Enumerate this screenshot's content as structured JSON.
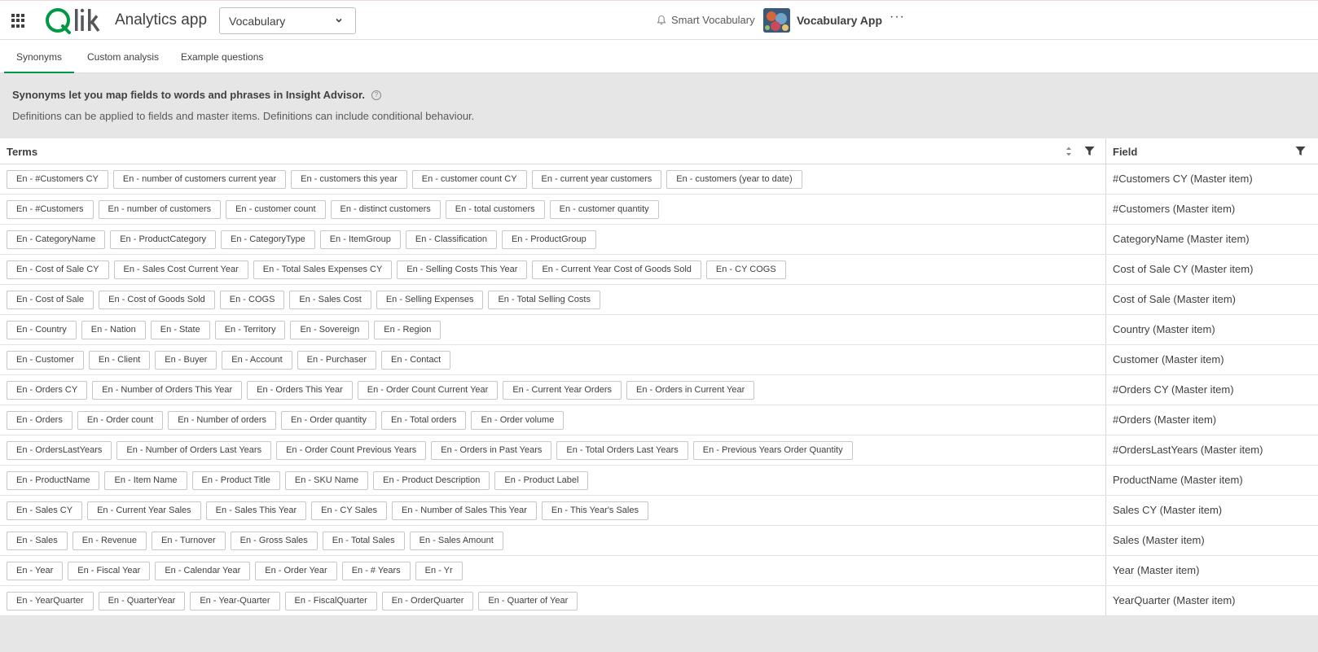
{
  "header": {
    "app_title": "Analytics app",
    "sheet_select_value": "Vocabulary",
    "smart_vocabulary_label": "Smart Vocabulary",
    "vocabulary_app_label": "Vocabulary App",
    "more_label": "···",
    "brand_color": "#009845"
  },
  "tabs": [
    {
      "label": "Synonyms",
      "active": true
    },
    {
      "label": "Custom analysis",
      "active": false
    },
    {
      "label": "Example questions",
      "active": false
    }
  ],
  "info": {
    "title": "Synonyms let you map fields to words and phrases in Insight Advisor.",
    "description": "Definitions can be applied to fields and master items. Definitions can include conditional behaviour."
  },
  "table": {
    "col_terms": "Terms",
    "col_field": "Field",
    "rows": [
      {
        "terms": [
          "En - #Customers CY",
          "En - number of customers current year",
          "En - customers this year",
          "En - customer count CY",
          "En - current year customers",
          "En - customers (year to date)"
        ],
        "field": "#Customers CY (Master item)"
      },
      {
        "terms": [
          "En - #Customers",
          "En - number of customers",
          "En - customer count",
          "En - distinct customers",
          "En - total customers",
          "En - customer quantity"
        ],
        "field": "#Customers (Master item)"
      },
      {
        "terms": [
          "En - CategoryName",
          "En - ProductCategory",
          "En - CategoryType",
          "En - ItemGroup",
          "En - Classification",
          "En - ProductGroup"
        ],
        "field": "CategoryName (Master item)"
      },
      {
        "terms": [
          "En - Cost of Sale CY",
          "En - Sales Cost Current Year",
          "En - Total Sales Expenses CY",
          "En - Selling Costs This Year",
          "En - Current Year Cost of Goods Sold",
          "En - CY COGS"
        ],
        "field": "Cost of Sale CY (Master item)"
      },
      {
        "terms": [
          "En - Cost of Sale",
          "En - Cost of Goods Sold",
          "En - COGS",
          "En - Sales Cost",
          "En - Selling Expenses",
          "En - Total Selling Costs"
        ],
        "field": "Cost of Sale (Master item)"
      },
      {
        "terms": [
          "En - Country",
          "En - Nation",
          "En - State",
          "En - Territory",
          "En - Sovereign",
          "En - Region"
        ],
        "field": "Country (Master item)"
      },
      {
        "terms": [
          "En - Customer",
          "En - Client",
          "En - Buyer",
          "En - Account",
          "En - Purchaser",
          "En - Contact"
        ],
        "field": "Customer (Master item)"
      },
      {
        "terms": [
          "En - Orders CY",
          "En - Number of Orders This Year",
          "En - Orders This Year",
          "En - Order Count Current Year",
          "En - Current Year Orders",
          "En - Orders in Current Year"
        ],
        "field": "#Orders CY (Master item)"
      },
      {
        "terms": [
          "En - Orders",
          "En - Order count",
          "En - Number of orders",
          "En - Order quantity",
          "En - Total orders",
          "En - Order volume"
        ],
        "field": "#Orders (Master item)"
      },
      {
        "terms": [
          "En - OrdersLastYears",
          "En - Number of Orders Last Years",
          "En - Order Count Previous Years",
          "En - Orders in Past Years",
          "En - Total Orders Last Years",
          "En - Previous Years Order Quantity"
        ],
        "field": "#OrdersLastYears (Master item)"
      },
      {
        "terms": [
          "En - ProductName",
          "En - Item Name",
          "En - Product Title",
          "En - SKU Name",
          "En - Product Description",
          "En - Product Label"
        ],
        "field": "ProductName (Master item)"
      },
      {
        "terms": [
          "En - Sales CY",
          "En - Current Year Sales",
          "En - Sales This Year",
          "En - CY Sales",
          "En - Number of Sales This Year",
          "En - This Year's Sales"
        ],
        "field": "Sales CY (Master item)"
      },
      {
        "terms": [
          "En - Sales",
          "En - Revenue",
          "En - Turnover",
          "En - Gross Sales",
          "En - Total Sales",
          "En - Sales Amount"
        ],
        "field": "Sales (Master item)"
      },
      {
        "terms": [
          "En - Year",
          "En - Fiscal Year",
          "En - Calendar Year",
          "En - Order Year",
          "En - # Years",
          "En - Yr"
        ],
        "field": "Year (Master item)"
      },
      {
        "terms": [
          "En - YearQuarter",
          "En - QuarterYear",
          "En - Year-Quarter",
          "En - FiscalQuarter",
          "En - OrderQuarter",
          "En - Quarter of Year"
        ],
        "field": "YearQuarter (Master item)"
      }
    ]
  }
}
